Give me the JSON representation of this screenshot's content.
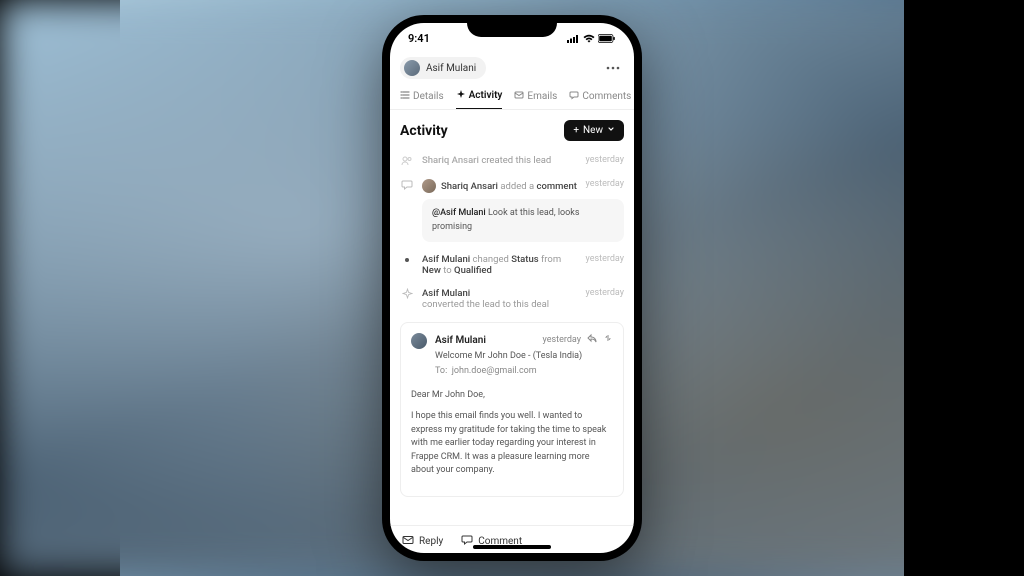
{
  "statusbar": {
    "time": "9:41"
  },
  "header": {
    "contact_name": "Asif Mulani"
  },
  "tabs": {
    "details": "Details",
    "activity": "Activity",
    "emails": "Emails",
    "comments": "Comments"
  },
  "section": {
    "title": "Activity",
    "new_label": "New"
  },
  "feed": {
    "created": {
      "actor": "Shariq Ansari",
      "action": "created this lead",
      "time": "yesterday"
    },
    "comment": {
      "actor": "Shariq Ansari",
      "action": "added a",
      "object": "comment",
      "time": "yesterday",
      "mention": "@Asif Mulani",
      "text": "Look at this lead, looks promising"
    },
    "status": {
      "actor": "Asif Mulani",
      "pre": "changed",
      "field": "Status",
      "mid": "from",
      "from": "New",
      "mid2": "to",
      "to": "Qualified",
      "time": "yesterday"
    },
    "converted": {
      "actor": "Asif Mulani",
      "action": "converted the lead to this deal",
      "time": "yesterday"
    },
    "email": {
      "actor": "Asif Mulani",
      "time": "yesterday",
      "subject": "Welcome Mr John Doe - (Tesla India)",
      "to_label": "To:",
      "to": "john.doe@gmail.com",
      "greeting": "Dear Mr John Doe,",
      "body": "I hope this email finds you well. I wanted to express my gratitude for taking the time to speak with me earlier today regarding your interest in Frappe CRM. It was a pleasure learning more about your company."
    }
  },
  "bottombar": {
    "reply": "Reply",
    "comment": "Comment"
  }
}
